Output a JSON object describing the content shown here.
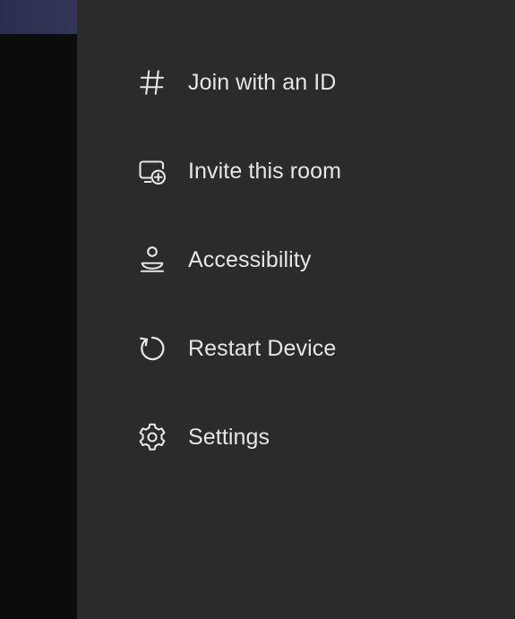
{
  "menu": {
    "items": [
      {
        "label": "Join with an ID",
        "icon": "hash-icon"
      },
      {
        "label": "Invite this room",
        "icon": "invite-device-icon"
      },
      {
        "label": "Accessibility",
        "icon": "accessibility-icon"
      },
      {
        "label": "Restart Device",
        "icon": "restart-icon"
      },
      {
        "label": "Settings",
        "icon": "gear-icon"
      }
    ]
  },
  "colors": {
    "panel_background": "#2c2b2b",
    "text": "#e6e6e6",
    "left_background": "#0c0c0c",
    "top_bar": "#2e3052"
  }
}
